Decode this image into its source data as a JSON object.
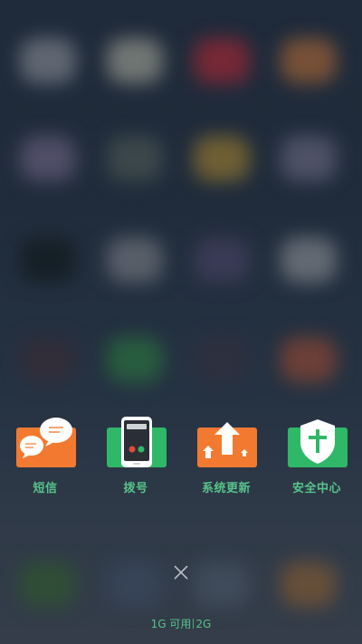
{
  "apps": [
    {
      "name": "sms",
      "label": "短信",
      "icon": "chat-bubbles-icon",
      "color": "#f27a30"
    },
    {
      "name": "dialer",
      "label": "拨号",
      "icon": "phone-icon",
      "color": "#2fb868"
    },
    {
      "name": "system-update",
      "label": "系统更新",
      "icon": "upload-arrow-icon",
      "color": "#f27a30"
    },
    {
      "name": "security-center",
      "label": "安全中心",
      "icon": "shield-icon",
      "color": "#2fb868"
    }
  ],
  "storage": {
    "available": "1G 可用",
    "total": "2G"
  },
  "colors": {
    "accent": "#56c38a",
    "orange": "#f27a30",
    "green": "#2fb868"
  }
}
